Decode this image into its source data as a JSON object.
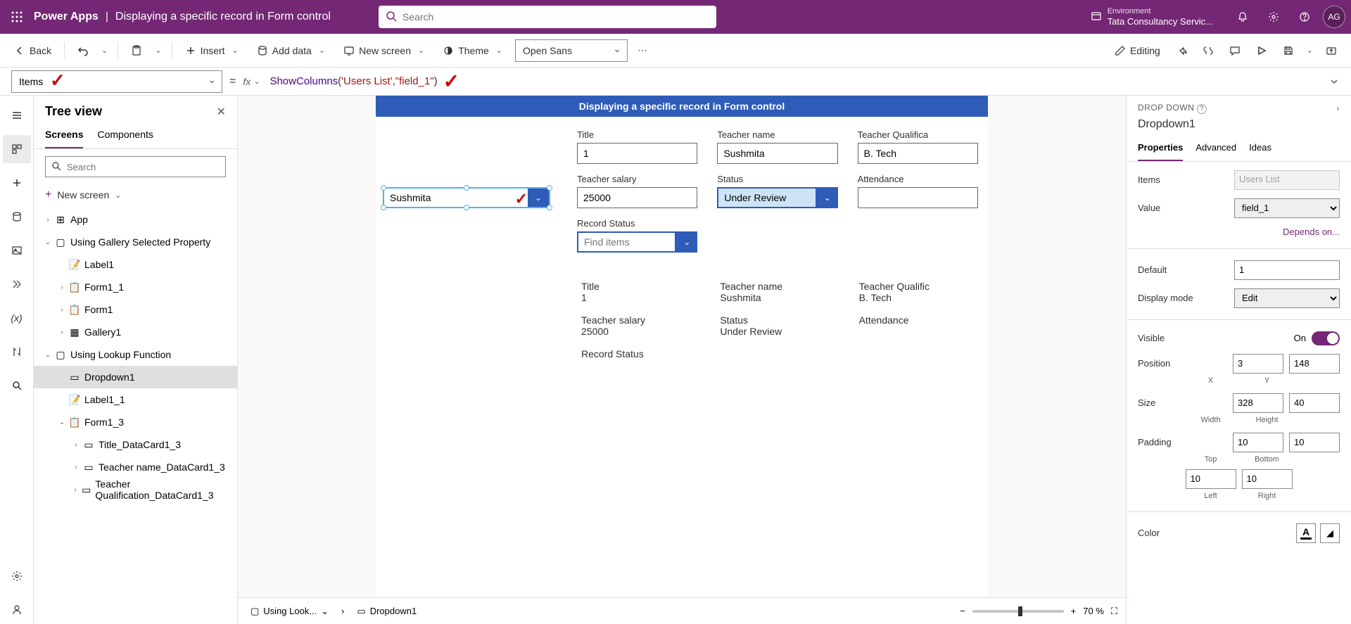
{
  "header": {
    "app": "Power Apps",
    "subtitle": "Displaying a specific record in Form control",
    "search_placeholder": "Search",
    "env_label": "Environment",
    "env_name": "Tata Consultancy Servic...",
    "avatar": "AG"
  },
  "toolbar": {
    "back": "Back",
    "insert": "Insert",
    "add_data": "Add data",
    "new_screen": "New screen",
    "theme": "Theme",
    "font": "Open Sans",
    "editing": "Editing"
  },
  "formula": {
    "property": "Items",
    "fx": "fx",
    "fn": "ShowColumns",
    "arg1": "'Users List'",
    "arg2": "\"field_1\""
  },
  "tree": {
    "title": "Tree view",
    "tabs": {
      "screens": "Screens",
      "components": "Components"
    },
    "search_placeholder": "Search",
    "new_screen": "New screen",
    "nodes": {
      "app": "App",
      "screen1": "Using Gallery Selected Property",
      "label1": "Label1",
      "form1_1": "Form1_1",
      "form1": "Form1",
      "gallery1": "Gallery1",
      "screen2": "Using Lookup Function",
      "dropdown1": "Dropdown1",
      "label1_1": "Label1_1",
      "form1_3": "Form1_3",
      "title_dc": "Title_DataCard1_3",
      "tname_dc": "Teacher name_DataCard1_3",
      "tqual_dc": "Teacher Qualification_DataCard1_3"
    }
  },
  "canvas": {
    "app_title": "Displaying a specific record in Form control",
    "dropdown_value": "Sushmita",
    "fields": {
      "title_l": "Title",
      "title_v": "1",
      "tname_l": "Teacher name",
      "tname_v": "Sushmita",
      "tqual_l": "Teacher Qualifica",
      "tqual_v": "B. Tech",
      "tsal_l": "Teacher salary",
      "tsal_v": "25000",
      "status_l": "Status",
      "status_v": "Under Review",
      "att_l": "Attendance",
      "att_v": "",
      "rstat_l": "Record Status",
      "rstat_ph": "Find items"
    },
    "display": {
      "title_l": "Title",
      "title_v": "1",
      "tname_l": "Teacher name",
      "tname_v": "Sushmita",
      "tqual_l": "Teacher Qualific",
      "tqual_v": "B. Tech",
      "tsal_l": "Teacher salary",
      "tsal_v": "25000",
      "status_l": "Status",
      "status_v": "Under Review",
      "att_l": "Attendance",
      "rstat_l": "Record Status"
    }
  },
  "breadcrumb": {
    "screen": "Using Look...",
    "control": "Dropdown1",
    "zoom": "70"
  },
  "props": {
    "type": "DROP DOWN",
    "name": "Dropdown1",
    "tabs": {
      "properties": "Properties",
      "advanced": "Advanced",
      "ideas": "Ideas"
    },
    "items_l": "Items",
    "items_v": "Users List",
    "value_l": "Value",
    "value_v": "field_1",
    "depends": "Depends on...",
    "default_l": "Default",
    "default_v": "1",
    "display_l": "Display mode",
    "display_v": "Edit",
    "visible_l": "Visible",
    "visible_on": "On",
    "position_l": "Position",
    "pos_x": "3",
    "pos_y": "148",
    "pos_xl": "X",
    "pos_yl": "Y",
    "size_l": "Size",
    "size_w": "328",
    "size_h": "40",
    "size_wl": "Width",
    "size_hl": "Height",
    "padding_l": "Padding",
    "pad_t": "10",
    "pad_b": "10",
    "pad_l": "10",
    "pad_r": "10",
    "pad_tl": "Top",
    "pad_bl": "Bottom",
    "pad_ll": "Left",
    "pad_rl": "Right",
    "color_l": "Color"
  }
}
